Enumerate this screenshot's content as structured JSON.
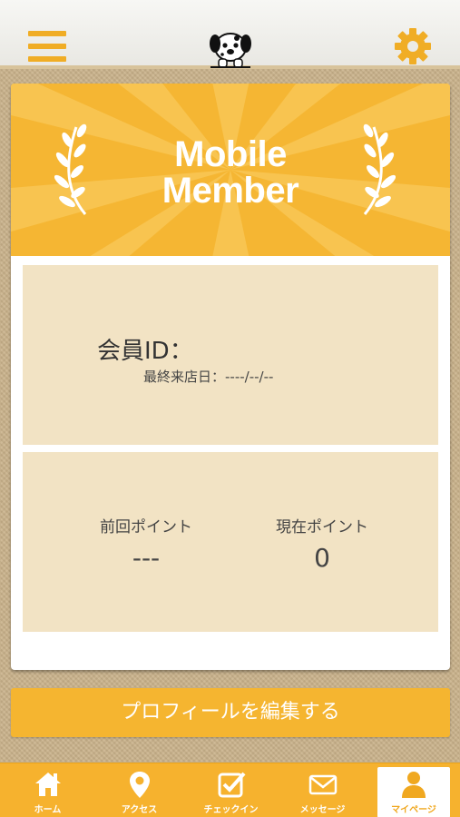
{
  "header": {
    "menu_icon": "hamburger-menu-icon",
    "logo": "dalmatian-dog-logo",
    "settings_icon": "gear-icon"
  },
  "card": {
    "banner_line1": "Mobile",
    "banner_line2": "Member",
    "member_id_label": "会員ID：",
    "last_visit": "最終来店日：----/--/--",
    "points": {
      "previous_label": "前回ポイント",
      "previous_value": "---",
      "current_label": "現在ポイント",
      "current_value": "0"
    }
  },
  "edit_profile_button": "プロフィールを編集する",
  "tabs": [
    {
      "label": "ホーム",
      "icon": "home-icon"
    },
    {
      "label": "アクセス",
      "icon": "map-pin-icon"
    },
    {
      "label": "チェックイン",
      "icon": "checkbox-icon"
    },
    {
      "label": "メッセージ",
      "icon": "envelope-icon"
    },
    {
      "label": "マイページ",
      "icon": "user-icon",
      "active": true
    }
  ],
  "colors": {
    "accent": "#f6b22e",
    "panel": "#f2e3c4",
    "background": "#c9b28a"
  }
}
